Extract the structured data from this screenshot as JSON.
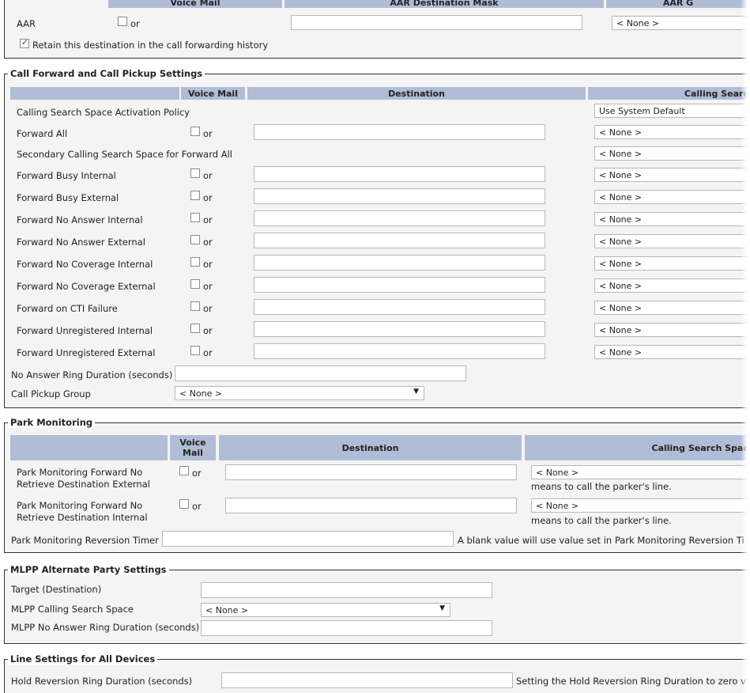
{
  "aar_section": {
    "headers": {
      "voice_mail": "Voice Mail",
      "destination_mask": "AAR Destination Mask",
      "aar_group": "AAR G"
    },
    "aar_label": "AAR",
    "or": "or",
    "retain_label": "Retain this destination in the call forwarding history",
    "retain_checked": true,
    "aar_select": "< None >"
  },
  "cf_section": {
    "legend": "Call Forward and Call Pickup Settings",
    "headers": {
      "voice_mail": "Voice Mail",
      "destination": "Destination",
      "css": "Calling Searc"
    },
    "activation_policy": {
      "label": "Calling Search Space Activation Policy",
      "value": "Use System Default"
    },
    "rows": [
      {
        "label": "Forward All",
        "css": "< None >"
      },
      {
        "label": "Secondary Calling Search Space for Forward All",
        "css": "< None >"
      },
      {
        "label": "Forward Busy Internal",
        "css": "< None >"
      },
      {
        "label": "Forward Busy External",
        "css": "< None >"
      },
      {
        "label": "Forward No Answer Internal",
        "css": "< None >"
      },
      {
        "label": "Forward No Answer External",
        "css": "< None >"
      },
      {
        "label": "Forward No Coverage Internal",
        "css": "< None >"
      },
      {
        "label": "Forward No Coverage External",
        "css": "< None >"
      },
      {
        "label": "Forward on CTI Failure",
        "css": "< None >"
      },
      {
        "label": "Forward Unregistered Internal",
        "css": "< None >"
      },
      {
        "label": "Forward Unregistered External",
        "css": "< None >"
      }
    ],
    "or": "or",
    "ring_duration_label": "No Answer Ring Duration (seconds)",
    "pickup_group_label": "Call Pickup Group",
    "pickup_group_value": "< None >"
  },
  "park_section": {
    "legend": "Park Monitoring",
    "headers": {
      "voice_mail": "Voice Mail",
      "destination": "Destination",
      "css": "Calling Search Spac"
    },
    "rows": [
      {
        "label": "Park Monitoring Forward No Retrieve Destination External",
        "css": "< None >",
        "hint": "means to call the parker's line."
      },
      {
        "label": "Park Monitoring Forward No Retrieve Destination Internal",
        "css": "< None >",
        "hint": "means to call the parker's line."
      }
    ],
    "or": "or",
    "timer_label": "Park Monitoring Reversion Timer",
    "timer_note": "A blank value will use value set in Park Monitoring Reversion Ti"
  },
  "mlpp_section": {
    "legend": "MLPP Alternate Party Settings",
    "target_label": "Target (Destination)",
    "css_label": "MLPP Calling Search Space",
    "css_value": "< None >",
    "ring_label": "MLPP No Answer Ring Duration (seconds)"
  },
  "line_section": {
    "legend": "Line Settings for All Devices",
    "hold_label": "Hold Reversion Ring Duration (seconds)",
    "hold_note": "Setting the Hold Reversion Ring Duration to zero v"
  }
}
